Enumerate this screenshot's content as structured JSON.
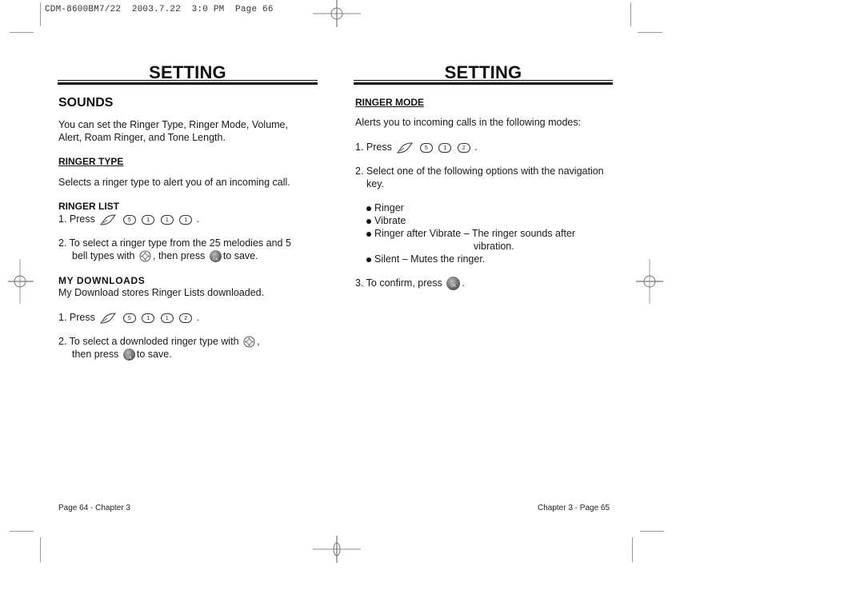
{
  "slug": "CDM-8600BM7/22  2003.7.22  3:0 PM  Page 66",
  "left_page": {
    "title": "SETTING",
    "section": "SOUNDS",
    "intro_line1": "You can set the Ringer Type, Ringer Mode, Volume,",
    "intro_line2": "Alert, Roam Ringer, and Tone Length.",
    "ringer_type": {
      "heading": "RINGER TYPE",
      "desc": "Selects a ringer type to alert you of an incoming call."
    },
    "ringer_list": {
      "heading": "RINGER LIST",
      "step1_prefix": "1. Press",
      "step1_keys": [
        "5",
        "1",
        "1",
        "1"
      ],
      "step1_key_labels": [
        "5JKL",
        "1",
        "1",
        "1"
      ],
      "step1_suffix": ".",
      "step2_line1": "2. To select a ringer type from the 25 melodies and 5",
      "step2_line2a": "bell types with",
      "step2_line2b": ", then press",
      "step2_line2c": "to save."
    },
    "my_downloads": {
      "heading": "MY DOWNLOADS",
      "desc": "My Download stores Ringer Lists downloaded.",
      "step1_prefix": "1. Press",
      "step1_keys": [
        "5",
        "1",
        "1",
        "2"
      ],
      "step1_suffix": ".",
      "step2_line1a": "2. To select a downloded ringer type with",
      "step2_line1b": ",",
      "step2_line2a": "then press",
      "step2_line2b": "to save."
    },
    "footer": "Page 64 - Chapter 3"
  },
  "right_page": {
    "title": "SETTING",
    "ringer_mode": {
      "heading": "RINGER MODE",
      "desc": "Alerts you to incoming calls in the following modes:",
      "step1_prefix": "1. Press",
      "step1_keys": [
        "5",
        "1",
        "2"
      ],
      "step1_suffix": ".",
      "step2_line1": "2. Select one of the following options with the navigation",
      "step2_line2": "key.",
      "options": [
        "Ringer",
        "Vibrate",
        "Ringer after Vibrate – The ringer sounds after",
        "Silent – Mutes the ringer."
      ],
      "option3_cont": "vibration.",
      "step3_prefix": "3. To confirm, press",
      "step3_suffix": "."
    },
    "footer": "Chapter 3 - Page 65"
  },
  "icons": {
    "menu_key": "menu-key-icon",
    "number_key": "number-key-icon",
    "nav_key": "navigation-key-icon",
    "ok_key": "ok-key-icon",
    "ok_label": "OK"
  }
}
